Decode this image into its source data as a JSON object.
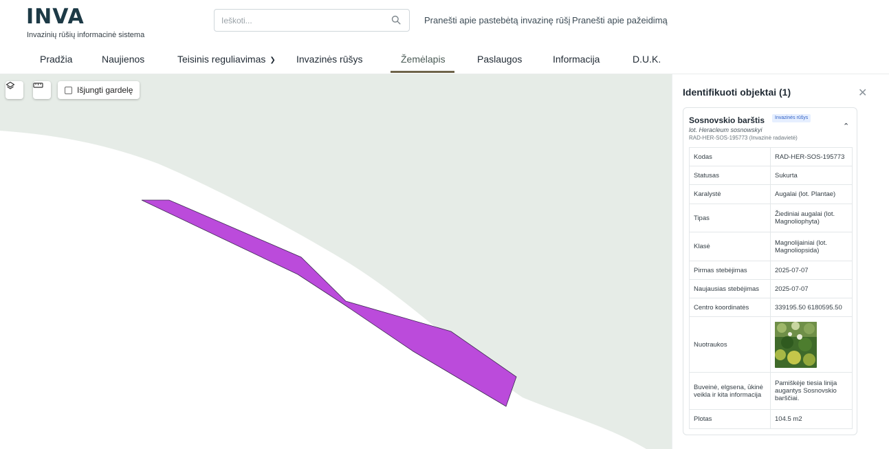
{
  "header": {
    "logo": "INVA",
    "subtitle": "Invazinių rūšių informacinė sistema",
    "search_placeholder": "Ieškoti...",
    "links": [
      "Pranešti apie pastebėtą invazinę rūšį",
      "Pranešti apie pažeidimą"
    ]
  },
  "nav": {
    "items": [
      {
        "label": "Pradžia"
      },
      {
        "label": "Naujienos"
      },
      {
        "label": "Teisinis reguliavimas"
      },
      {
        "label": "Invazinės rūšys"
      },
      {
        "label": "Žemėlapis"
      },
      {
        "label": "Paslaugos"
      },
      {
        "label": "Informacija"
      },
      {
        "label": "D.U.K."
      }
    ],
    "active": "Žemėlapis"
  },
  "map": {
    "grid_toggle_label": "Išjungti gardelę",
    "grid_toggle_checked": false,
    "land_color": "#e6ece7",
    "polygon_color": "#bb4bdb"
  },
  "panel": {
    "title": "Identifikuoti objektai (1)",
    "card": {
      "name": "Sosnovskio barštis",
      "badge": "Invazinės rūšys",
      "latin": "lot. Heracleum sosnowskyi",
      "code_line": "RAD-HER-SOS-195773 (Invazinė radavietė)",
      "rows": [
        {
          "key": "Kodas",
          "value": "RAD-HER-SOS-195773"
        },
        {
          "key": "Statusas",
          "value": "Sukurta"
        },
        {
          "key": "Karalystė",
          "value": "Augalai (lot. Plantae)"
        },
        {
          "key": "Tipas",
          "value": "Žiediniai augalai (lot. Magnoliophyta)"
        },
        {
          "key": "Klasė",
          "value": "Magnolijainiai (lot. Magnoliopsida)"
        },
        {
          "key": "Pirmas stebėjimas",
          "value": "2025-07-07"
        },
        {
          "key": "Naujausias stebėjimas",
          "value": "2025-07-07"
        },
        {
          "key": "Centro koordinatės",
          "value": "339195.50 6180595.50"
        },
        {
          "key": "Nuotraukos",
          "value": ""
        },
        {
          "key": "Buveinė, elgsena, ūkinė veikla ir kita informacija",
          "value": "Pamiškėje tiesia linija augantys Sosnovskio barščiai."
        },
        {
          "key": "Plotas",
          "value": "104.5 m2"
        }
      ]
    }
  }
}
